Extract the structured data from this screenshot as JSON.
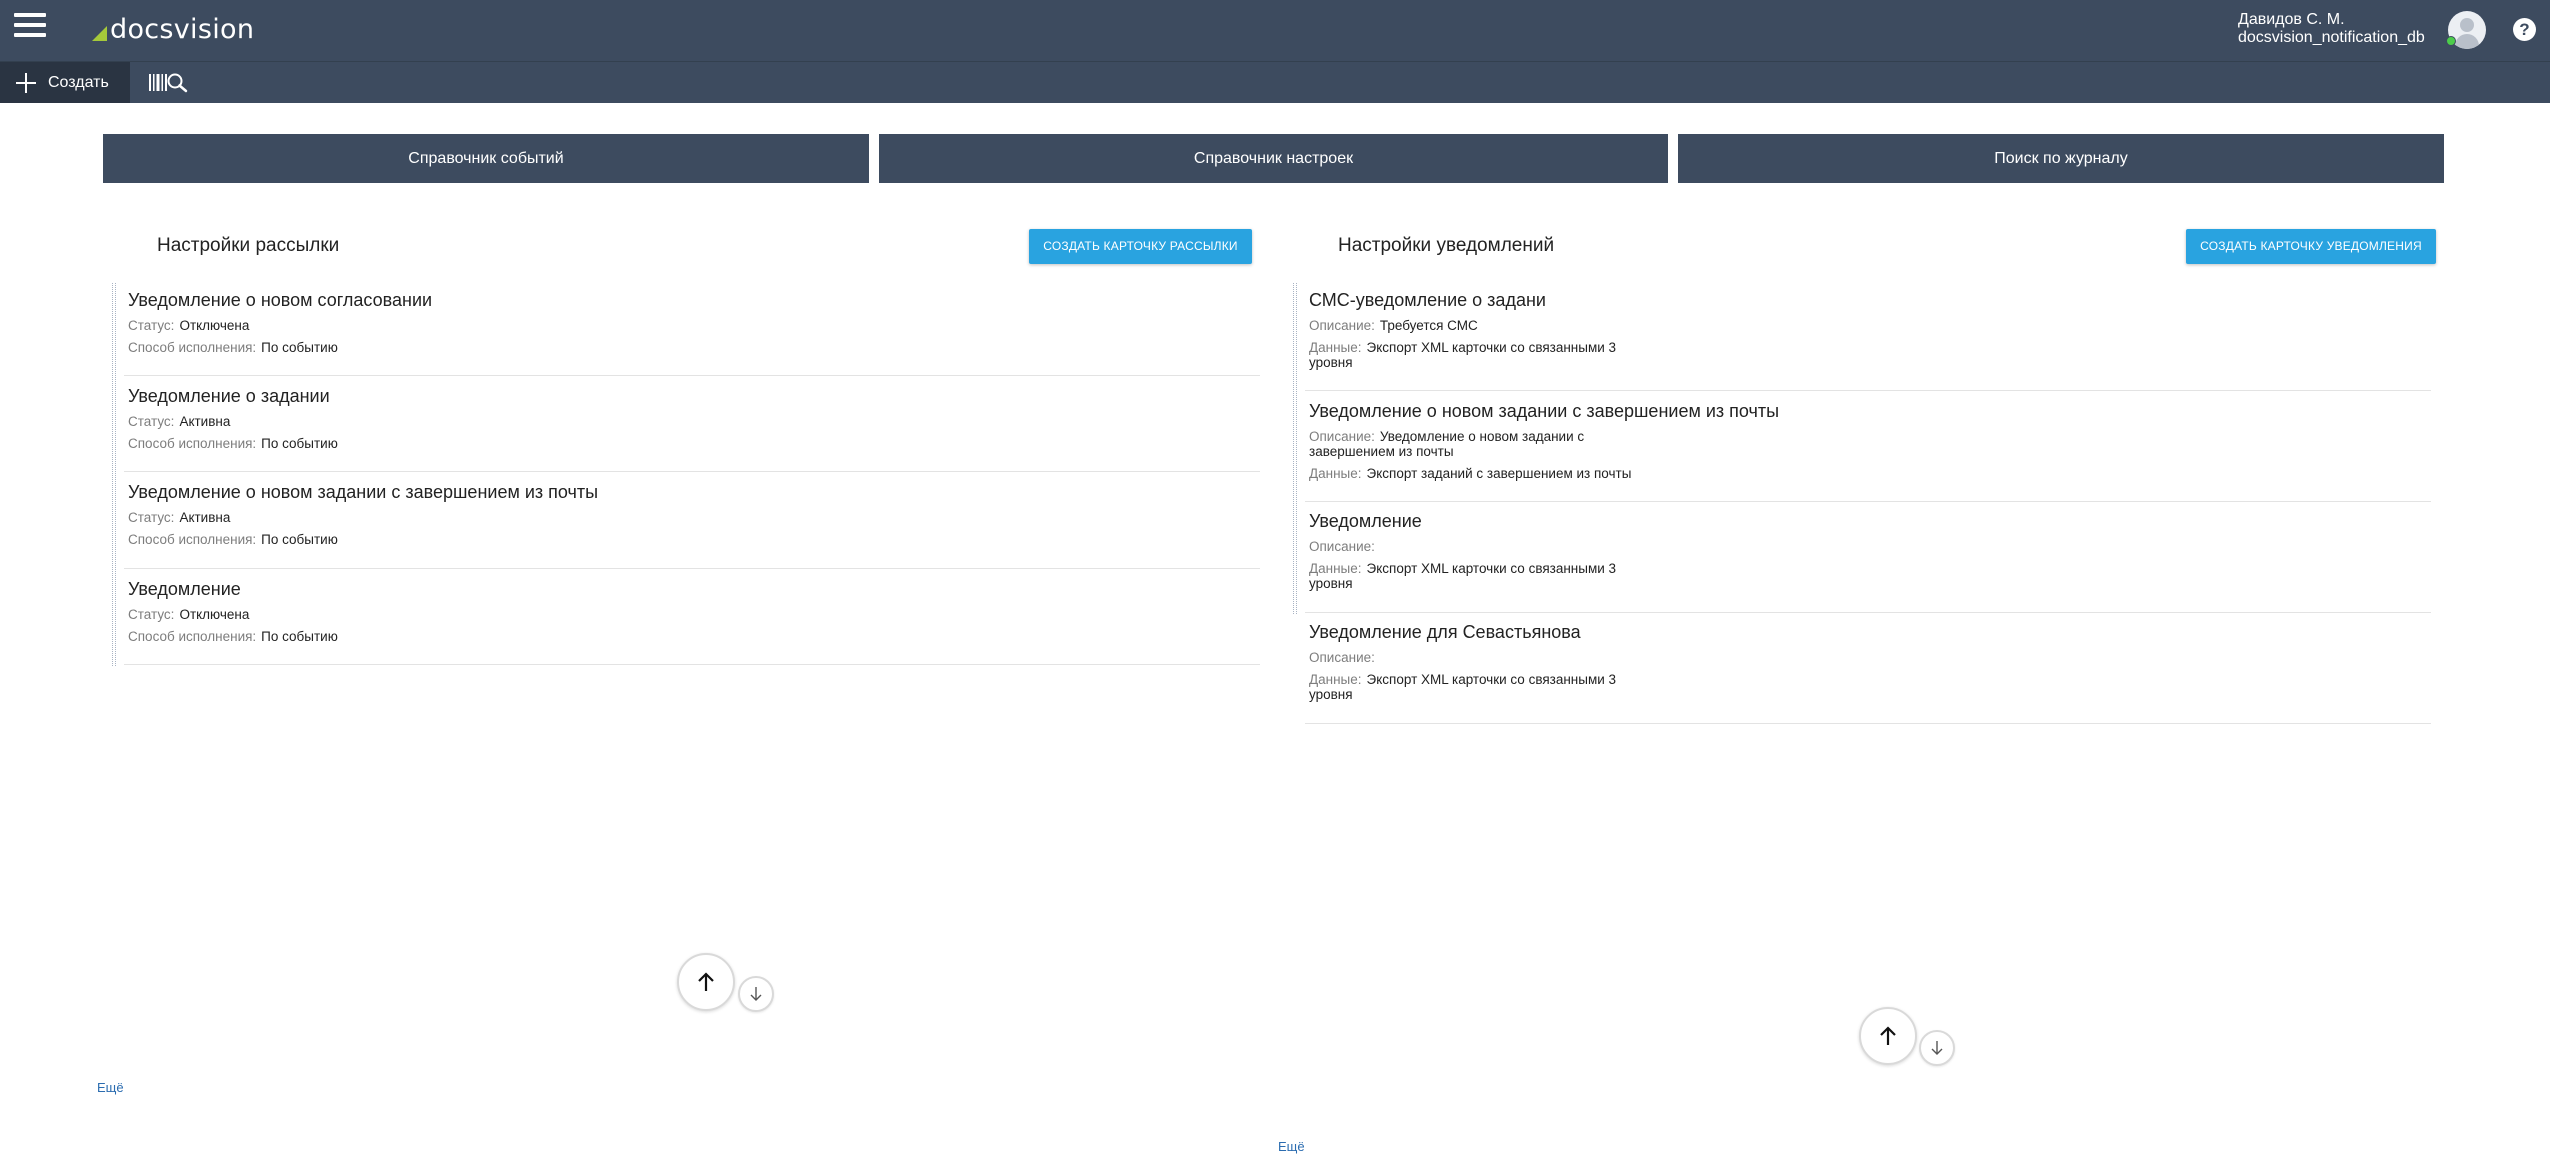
{
  "header": {
    "logo_text": "docsvision",
    "user_name": "Давидов С. М.",
    "db_name": "docsvision_notification_db",
    "help_label": "?"
  },
  "toolbar": {
    "create_label": "Создать"
  },
  "tiles": [
    {
      "label": "Справочник событий"
    },
    {
      "label": "Справочник настроек"
    },
    {
      "label": "Поиск по журналу"
    }
  ],
  "mailing": {
    "title": "Настройки рассылки",
    "create_button": "СОЗДАТЬ КАРТОЧКУ РАССЫЛКИ",
    "status_key": "Статус:",
    "mode_key": "Способ исполнения:",
    "items": [
      {
        "title": "Уведомление о новом согласовании",
        "status": "Отключена",
        "mode": "По событию"
      },
      {
        "title": "Уведомление о задании",
        "status": "Активна",
        "mode": "По событию"
      },
      {
        "title": "Уведомление о новом задании с завершением из почты",
        "status": "Активна",
        "mode": "По событию"
      },
      {
        "title": "Уведомление",
        "status": "Отключена",
        "mode": "По событию"
      }
    ],
    "more_label": "Ещё"
  },
  "notifications": {
    "title": "Настройки уведомлений",
    "create_button": "СОЗДАТЬ КАРТОЧКУ УВЕДОМЛЕНИЯ",
    "desc_key": "Описание:",
    "data_key": "Данные:",
    "items": [
      {
        "title": "СМС-уведомление о задани",
        "description": "Требуется СМС",
        "data": "Экспорт XML карточки со связанными 3 уровня"
      },
      {
        "title": "Уведомление о новом задании с завершением из почты",
        "description": "Уведомление о новом задании с завершением из почты",
        "data": "Экспорт заданий с завершением из почты"
      },
      {
        "title": "Уведомление",
        "description": "",
        "data": "Экспорт XML карточки со связанными 3 уровня"
      },
      {
        "title": "Уведомление для Севастьянова",
        "description": "",
        "data": "Экспорт XML карточки со связанными 3 уровня"
      }
    ],
    "more_label": "Ещё"
  },
  "icons": {
    "menu": "hamburger-menu-icon",
    "logo": "docsvision-logo",
    "avatar": "user-avatar-icon",
    "help": "help-icon",
    "create": "plus-icon",
    "barcode": "barcode-search-icon",
    "scroll_up": "arrow-up-icon",
    "scroll_down": "arrow-down-icon"
  },
  "colors": {
    "header_bg": "#3d4b5f",
    "create_bg": "#2a3442",
    "accent_button": "#29a3e0",
    "logo_mark": "#a5c93a",
    "online": "#4ccd4a",
    "link": "#2b6cb0"
  }
}
